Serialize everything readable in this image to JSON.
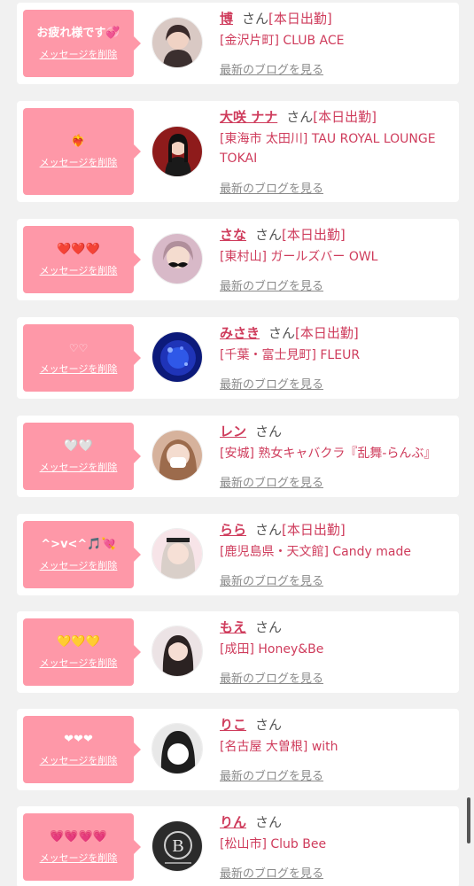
{
  "delete_label": "メッセージを削除",
  "blog_label": "最新のブログを見る",
  "san": "さん",
  "items": [
    {
      "message": "お疲れ様です💞",
      "name": "博",
      "status": "[本日出勤]",
      "shop": "[金沢片町] CLUB ACE",
      "avatar_color": "#4a3a3a"
    },
    {
      "message": "❤️‍🔥",
      "name": "大咲 ナナ",
      "status": "[本日出勤]",
      "shop": "[東海市 太田川] TAU ROYAL LOUNGE TOKAI",
      "avatar_color": "#8e1b1b"
    },
    {
      "message": "❤️❤️❤️",
      "name": "さな",
      "status": "[本日出勤]",
      "shop": "[東村山] ガールズバー OWL",
      "avatar_color": "#c7a4b5"
    },
    {
      "message": "♡♡",
      "name": "みさき",
      "status": "[本日出勤]",
      "shop": "[千葉・富士見町] FLEUR",
      "avatar_color": "#1f34b8"
    },
    {
      "message": "🤍🤍",
      "name": "レン",
      "status": "",
      "shop": "[安城] 熟女キャバクラ『乱舞-らんぶ』",
      "avatar_color": "#e8c6b0"
    },
    {
      "message": "^>v<^🎵💘",
      "name": "らら",
      "status": "[本日出勤]",
      "shop": "[鹿児島県・天文館] Candy made",
      "avatar_color": "#f3d9de"
    },
    {
      "message": "💛💛💛",
      "name": "もえ",
      "status": "",
      "shop": "[成田] Honey&Be",
      "avatar_color": "#e9d8dc"
    },
    {
      "message": "❤❤❤",
      "name": "りこ",
      "status": "",
      "shop": "[名古屋 大曽根] with",
      "avatar_color": "#2a2a2a"
    },
    {
      "message": "💗💗💗💗",
      "name": "りん",
      "status": "",
      "shop": "[松山市] Club Bee",
      "avatar_color": "#2b2b2b",
      "avatar_letter": "B"
    }
  ]
}
